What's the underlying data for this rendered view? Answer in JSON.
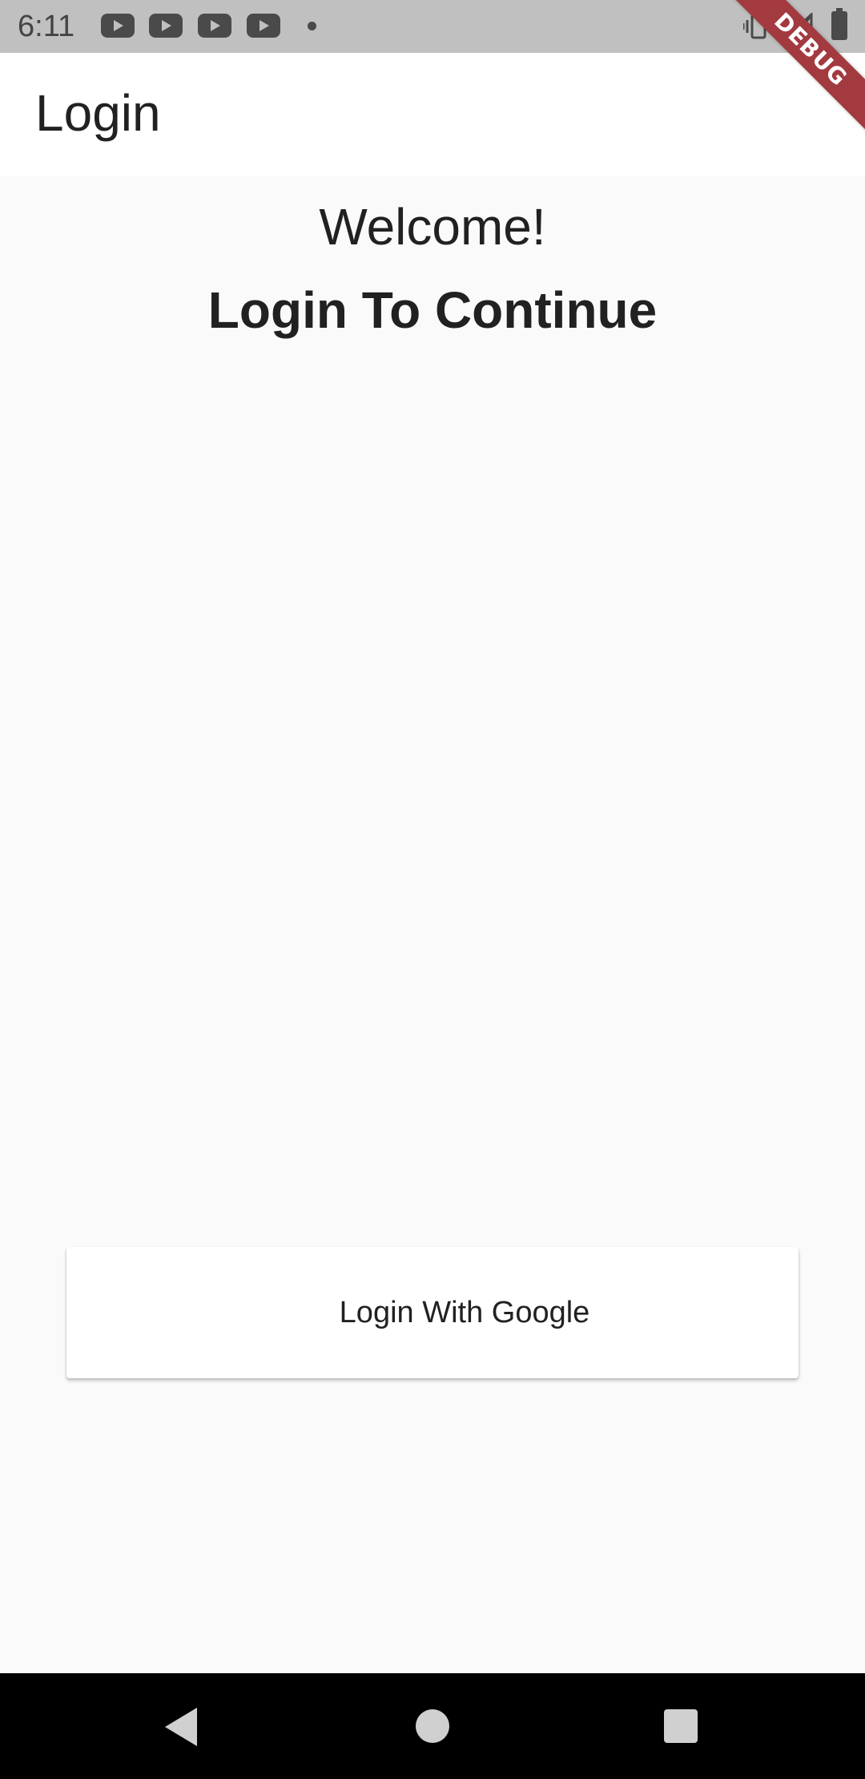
{
  "status_bar": {
    "time": "6:11",
    "icons": [
      "youtube-notification-icon",
      "youtube-notification-icon",
      "youtube-notification-icon",
      "youtube-notification-icon",
      "more-notifications-dot",
      "vibrate-icon",
      "signal-icon",
      "battery-icon"
    ]
  },
  "app_bar": {
    "title": "Login"
  },
  "debug_banner": {
    "label": "DEBUG"
  },
  "main": {
    "welcome_text": "Welcome!",
    "subtitle_text": "Login To Continue",
    "google_button_label": "Login With Google"
  },
  "nav_bar": {
    "buttons": [
      "back",
      "home",
      "recents"
    ]
  },
  "colors": {
    "status_bar_bg": "#c0c0c0",
    "app_bar_bg": "#ffffff",
    "page_bg": "#fafafa",
    "text": "#212121",
    "debug_banner": "#a33a3f",
    "nav_bar_bg": "#000000"
  }
}
